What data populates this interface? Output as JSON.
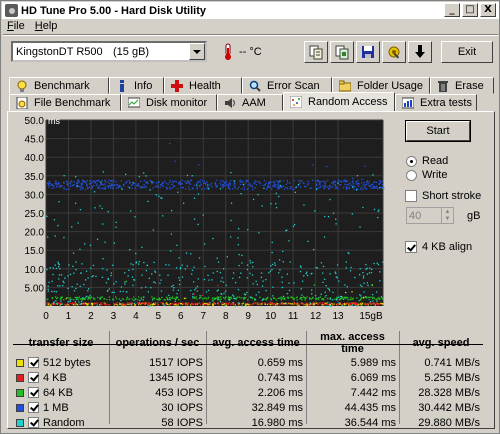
{
  "window": {
    "title": "HD Tune Pro 5.00 - Hard Disk Utility",
    "controls": [
      "_",
      "□",
      "X"
    ]
  },
  "menu": [
    "File",
    "Help"
  ],
  "toolbar": {
    "drive_name": "KingstonDT R500",
    "drive_size": "(15 gB)",
    "temperature": "-- °C",
    "exit_label": "Exit",
    "icons": [
      "copy-info-icon",
      "copy-screen-icon",
      "save-icon",
      "options-icon",
      "download-icon"
    ]
  },
  "tabs_top": [
    {
      "label": "Benchmark",
      "icon": "lightbulb-icon"
    },
    {
      "label": "Info",
      "icon": "info-icon"
    },
    {
      "label": "Health",
      "icon": "health-cross-icon"
    },
    {
      "label": "Error Scan",
      "icon": "magnifier-icon"
    },
    {
      "label": "Folder Usage",
      "icon": "folder-icon"
    },
    {
      "label": "Erase",
      "icon": "trash-icon"
    }
  ],
  "tabs_bottom": [
    {
      "label": "File Benchmark",
      "icon": "file-benchmark-icon"
    },
    {
      "label": "Disk monitor",
      "icon": "disk-monitor-icon"
    },
    {
      "label": "AAM",
      "icon": "speaker-icon"
    },
    {
      "label": "Random Access",
      "icon": "random-access-icon",
      "active": true
    },
    {
      "label": "Extra tests",
      "icon": "extra-tests-icon"
    }
  ],
  "side_panel": {
    "start_label": "Start",
    "read_label": "Read",
    "write_label": "Write",
    "mode": "read",
    "short_stroke_label": "Short stroke",
    "short_stroke_checked": false,
    "short_stroke_value": "40",
    "short_stroke_unit": "gB",
    "align_label": "4 KB align",
    "align_checked": true
  },
  "chart_data": {
    "type": "scatter",
    "ylabel": "ms",
    "xlabel": "",
    "x_unit": "gB",
    "ylim": [
      0,
      50
    ],
    "xlim": [
      0,
      15
    ],
    "yticks": [
      "50.0",
      "45.0",
      "40.0",
      "35.0",
      "30.0",
      "25.0",
      "20.0",
      "15.0",
      "10.0",
      "5.00"
    ],
    "xticks": [
      "0",
      "1",
      "2",
      "3",
      "4",
      "5",
      "6",
      "7",
      "8",
      "9",
      "10",
      "11",
      "12",
      "13",
      "15gB"
    ],
    "grid": true,
    "background": "#1e1e1e",
    "series": [
      {
        "name": "512 bytes",
        "color": "#f0e000",
        "band_ms": [
          0.4,
          1.0
        ],
        "avg_ms": 0.659,
        "max_ms": 5.989
      },
      {
        "name": "4 KB",
        "color": "#e02020",
        "band_ms": [
          0.5,
          1.1
        ],
        "avg_ms": 0.743,
        "max_ms": 6.069
      },
      {
        "name": "64 KB",
        "color": "#20c020",
        "band_ms": [
          1.8,
          2.6
        ],
        "avg_ms": 2.206,
        "max_ms": 7.442
      },
      {
        "name": "1 MB",
        "color": "#2050e0",
        "band_ms": [
          31.5,
          34.0
        ],
        "avg_ms": 32.849,
        "max_ms": 44.435
      },
      {
        "name": "Random",
        "color": "#20d0d0",
        "band_ms": [
          0,
          36.5
        ],
        "avg_ms": 16.98,
        "max_ms": 36.544
      }
    ]
  },
  "results": {
    "headers": [
      "transfer size",
      "operations / sec",
      "avg. access time",
      "max. access time",
      "avg. speed"
    ],
    "rows": [
      {
        "color": "#f0e000",
        "size": "512 bytes",
        "ops": "1517 IOPS",
        "avg": "0.659 ms",
        "max": "5.989 ms",
        "speed": "0.741 MB/s"
      },
      {
        "color": "#e02020",
        "size": "4 KB",
        "ops": "1345 IOPS",
        "avg": "0.743 ms",
        "max": "6.069 ms",
        "speed": "5.255 MB/s"
      },
      {
        "color": "#20c020",
        "size": "64 KB",
        "ops": "453 IOPS",
        "avg": "2.206 ms",
        "max": "7.442 ms",
        "speed": "28.328 MB/s"
      },
      {
        "color": "#2050e0",
        "size": "1 MB",
        "ops": "30 IOPS",
        "avg": "32.849 ms",
        "max": "44.435 ms",
        "speed": "30.442 MB/s"
      },
      {
        "color": "#20d0d0",
        "size": "Random",
        "ops": "58 IOPS",
        "avg": "16.980 ms",
        "max": "36.544 ms",
        "speed": "29.880 MB/s"
      }
    ]
  }
}
